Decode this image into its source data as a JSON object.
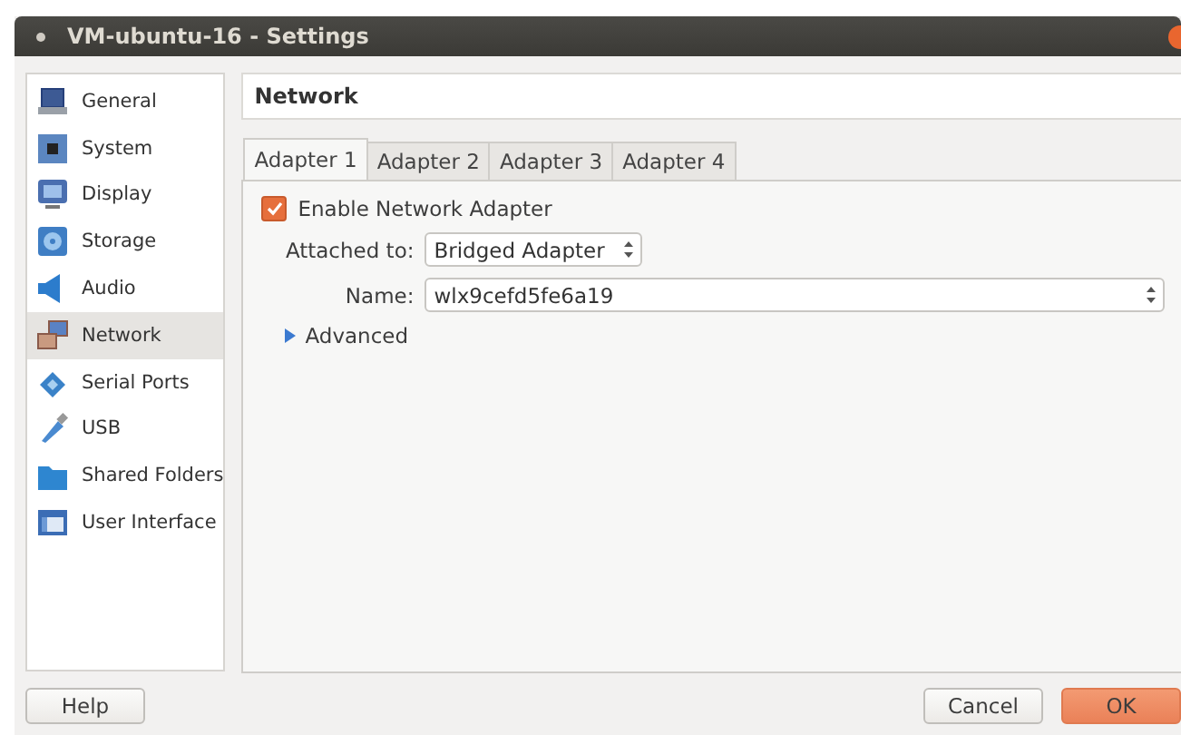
{
  "window": {
    "title": "VM-ubuntu-16 - Settings"
  },
  "sidebar": {
    "items": [
      {
        "label": "General",
        "kind": "general",
        "selected": false
      },
      {
        "label": "System",
        "kind": "system",
        "selected": false
      },
      {
        "label": "Display",
        "kind": "display",
        "selected": false
      },
      {
        "label": "Storage",
        "kind": "storage",
        "selected": false
      },
      {
        "label": "Audio",
        "kind": "audio",
        "selected": false
      },
      {
        "label": "Network",
        "kind": "network",
        "selected": true
      },
      {
        "label": "Serial Ports",
        "kind": "serial",
        "selected": false
      },
      {
        "label": "USB",
        "kind": "usb",
        "selected": false
      },
      {
        "label": "Shared Folders",
        "kind": "folder",
        "selected": false
      },
      {
        "label": "User Interface",
        "kind": "ui",
        "selected": false
      }
    ]
  },
  "page": {
    "title": "Network",
    "tabs": [
      {
        "label": "Adapter 1",
        "selected": true
      },
      {
        "label": "Adapter 2",
        "selected": false
      },
      {
        "label": "Adapter 3",
        "selected": false
      },
      {
        "label": "Adapter 4",
        "selected": false
      }
    ],
    "enable": {
      "label": "Enable Network Adapter",
      "checked": true
    },
    "attached_to": {
      "label": "Attached to:",
      "value": "Bridged Adapter"
    },
    "name": {
      "label": "Name:",
      "value": "wlx9cefd5fe6a19"
    },
    "advanced": {
      "label": "Advanced",
      "expanded": false
    }
  },
  "buttons": {
    "help": "Help",
    "cancel": "Cancel",
    "ok": "OK"
  }
}
